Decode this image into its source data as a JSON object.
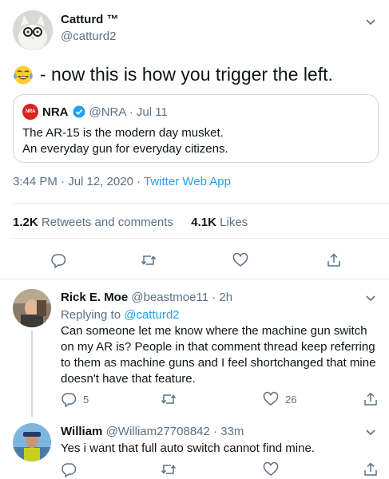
{
  "main_tweet": {
    "author_name": "Catturd ™",
    "author_handle": "@catturd2",
    "text": "- now this is how you trigger the left.",
    "emoji_icon": "tears-of-joy-emoji",
    "quoted": {
      "logo_text": "NRA",
      "author_name": "NRA",
      "handle_date": "@NRA · Jul 11",
      "line1": "The AR-15 is the modern day musket.",
      "line2": "An everyday gun for everyday citizens."
    },
    "time": "3:44 PM · Jul 12, 2020",
    "separator": " · ",
    "source": "Twitter Web App",
    "retweets_count": "1.2K",
    "retweets_label": "Retweets and comments",
    "likes_count": "4.1K",
    "likes_label": "Likes"
  },
  "replies": [
    {
      "author_name": "Rick E. Moe",
      "handle_time": "@beastmoe11 · 2h",
      "replying_prefix": "Replying to ",
      "replying_to": "@catturd2",
      "text": "Can someone let me know where the machine gun switch on my AR is? People in that comment thread keep referring to them as machine guns and I feel shortchanged that mine doesn't have that feature.",
      "reply_count": "5",
      "retweet_count": "",
      "like_count": "26"
    },
    {
      "author_name": "William",
      "handle_time": "@William27708842 · 33m",
      "text": "Yes i want that full auto switch cannot find mine.",
      "reply_count": "",
      "retweet_count": "",
      "like_count": ""
    }
  ],
  "colors": {
    "accent": "#1da1f2",
    "secondary_text": "#5b7083",
    "nra_red": "#d9231d"
  }
}
